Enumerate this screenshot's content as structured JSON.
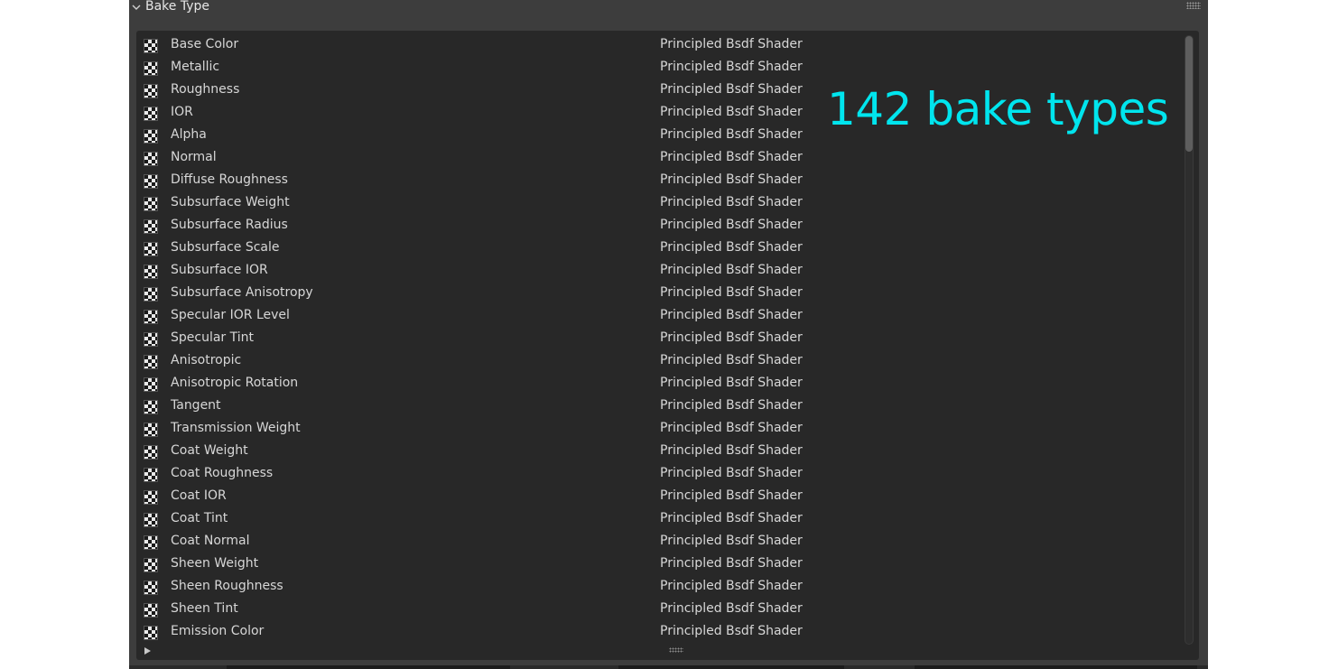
{
  "header": {
    "title": "Bake Type"
  },
  "overlay_text": "142 bake types",
  "bake_types": [
    {
      "name": "Base Color",
      "shader": "Principled Bsdf Shader"
    },
    {
      "name": "Metallic",
      "shader": "Principled Bsdf Shader"
    },
    {
      "name": "Roughness",
      "shader": "Principled Bsdf Shader"
    },
    {
      "name": "IOR",
      "shader": "Principled Bsdf Shader"
    },
    {
      "name": "Alpha",
      "shader": "Principled Bsdf Shader"
    },
    {
      "name": "Normal",
      "shader": "Principled Bsdf Shader"
    },
    {
      "name": "Diffuse Roughness",
      "shader": "Principled Bsdf Shader"
    },
    {
      "name": "Subsurface Weight",
      "shader": "Principled Bsdf Shader"
    },
    {
      "name": "Subsurface Radius",
      "shader": "Principled Bsdf Shader"
    },
    {
      "name": "Subsurface Scale",
      "shader": "Principled Bsdf Shader"
    },
    {
      "name": "Subsurface IOR",
      "shader": "Principled Bsdf Shader"
    },
    {
      "name": "Subsurface Anisotropy",
      "shader": "Principled Bsdf Shader"
    },
    {
      "name": "Specular IOR Level",
      "shader": "Principled Bsdf Shader"
    },
    {
      "name": "Specular Tint",
      "shader": "Principled Bsdf Shader"
    },
    {
      "name": "Anisotropic",
      "shader": "Principled Bsdf Shader"
    },
    {
      "name": "Anisotropic Rotation",
      "shader": "Principled Bsdf Shader"
    },
    {
      "name": "Tangent",
      "shader": "Principled Bsdf Shader"
    },
    {
      "name": "Transmission Weight",
      "shader": "Principled Bsdf Shader"
    },
    {
      "name": "Coat Weight",
      "shader": "Principled Bsdf Shader"
    },
    {
      "name": "Coat Roughness",
      "shader": "Principled Bsdf Shader"
    },
    {
      "name": "Coat IOR",
      "shader": "Principled Bsdf Shader"
    },
    {
      "name": "Coat Tint",
      "shader": "Principled Bsdf Shader"
    },
    {
      "name": "Coat Normal",
      "shader": "Principled Bsdf Shader"
    },
    {
      "name": "Sheen Weight",
      "shader": "Principled Bsdf Shader"
    },
    {
      "name": "Sheen Roughness",
      "shader": "Principled Bsdf Shader"
    },
    {
      "name": "Sheen Tint",
      "shader": "Principled Bsdf Shader"
    },
    {
      "name": "Emission Color",
      "shader": "Principled Bsdf Shader"
    }
  ],
  "icons": {
    "panel_collapse": "chevron-down-icon",
    "row_icon": "checkerboard-texture-icon",
    "expand": "triangle-right-icon"
  },
  "colors": {
    "overlay_text": "#00e5ee",
    "panel_bg": "#3d3d3d",
    "list_bg": "#282828"
  }
}
